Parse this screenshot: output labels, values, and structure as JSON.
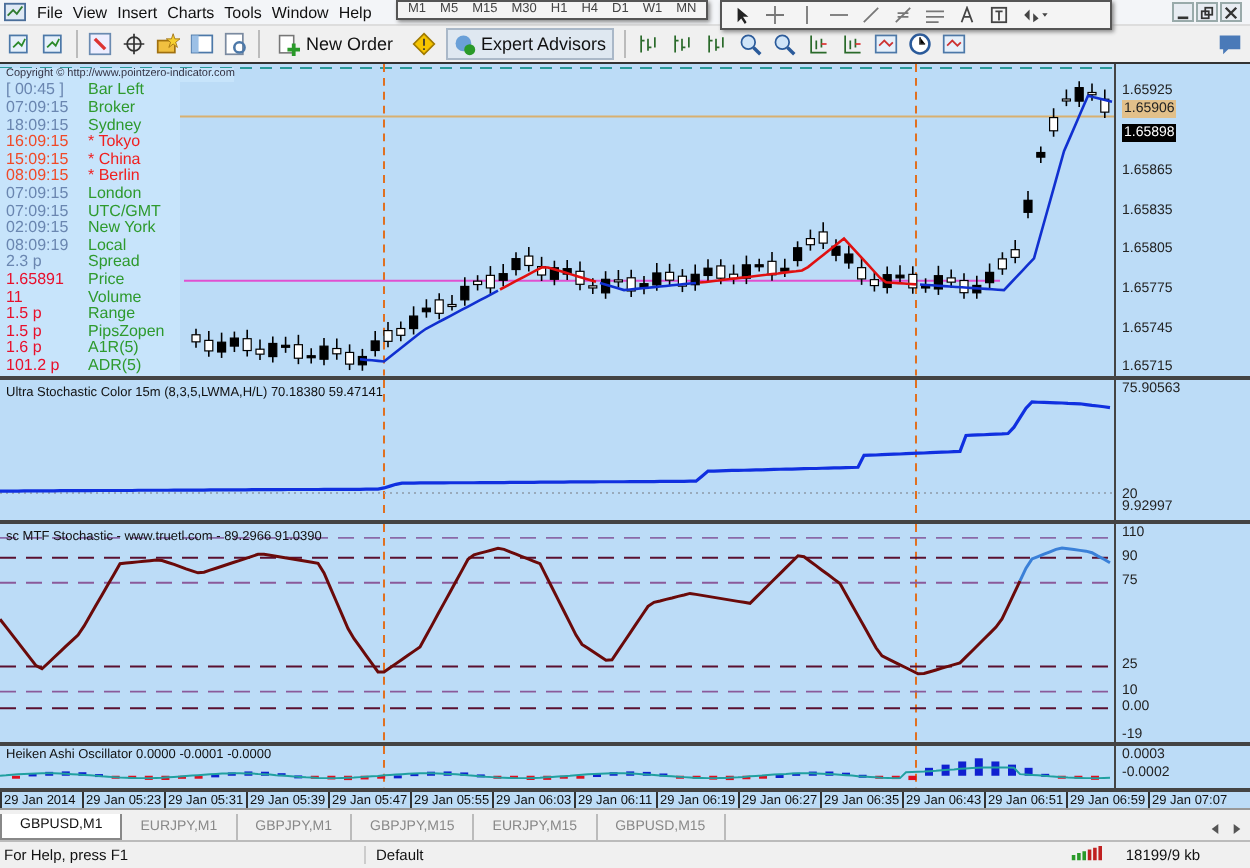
{
  "menu": [
    "File",
    "View",
    "Insert",
    "Charts",
    "Tools",
    "Window",
    "Help"
  ],
  "timeframes": [
    "M1",
    "M5",
    "M15",
    "M30",
    "H1",
    "H4",
    "D1",
    "W1",
    "MN"
  ],
  "toolbar": {
    "new_order": "New Order",
    "expert_advisors": "Expert Advisors"
  },
  "main_chart": {
    "copyright": "Copyright © http://www.pointzero-indicator.com",
    "info_rows": [
      {
        "value": {
          "text": "[ 00:45 ]",
          "color": "#6a86b0"
        },
        "label": {
          "text": "Bar Left",
          "color": "#2e9a2e"
        }
      },
      {
        "value": {
          "text": "07:09:15",
          "color": "#6a86b0"
        },
        "label": {
          "text": "Broker",
          "color": "#2e9a2e"
        }
      },
      {
        "value": {
          "text": "18:09:15",
          "color": "#6a86b0"
        },
        "label": {
          "text": "Sydney",
          "color": "#2e9a2e"
        }
      },
      {
        "value": {
          "text": "16:09:15",
          "color": "#f04a28"
        },
        "label": {
          "text": "* Tokyo",
          "color": "#f02020"
        }
      },
      {
        "value": {
          "text": "15:09:15",
          "color": "#f04a28"
        },
        "label": {
          "text": "* China",
          "color": "#f02020"
        }
      },
      {
        "value": {
          "text": "08:09:15",
          "color": "#f04a28"
        },
        "label": {
          "text": "* Berlin",
          "color": "#f02020"
        }
      },
      {
        "value": {
          "text": "07:09:15",
          "color": "#6a86b0"
        },
        "label": {
          "text": "London",
          "color": "#2e9a2e"
        }
      },
      {
        "value": {
          "text": "07:09:15",
          "color": "#6a86b0"
        },
        "label": {
          "text": "UTC/GMT",
          "color": "#2e9a2e"
        }
      },
      {
        "value": {
          "text": "02:09:15",
          "color": "#6a86b0"
        },
        "label": {
          "text": "New York",
          "color": "#2e9a2e"
        }
      },
      {
        "value": {
          "text": "08:09:19",
          "color": "#6a86b0"
        },
        "label": {
          "text": "Local",
          "color": "#2e9a2e"
        }
      },
      {
        "value": {
          "text": "2.3 p",
          "color": "#6a86b0"
        },
        "label": {
          "text": "Spread",
          "color": "#2e9a2e"
        }
      },
      {
        "value": {
          "text": "1.65891",
          "color": "#e8102c"
        },
        "label": {
          "text": "Price",
          "color": "#2e9a2e"
        }
      },
      {
        "value": {
          "text": "11",
          "color": "#e8102c"
        },
        "label": {
          "text": "Volume",
          "color": "#2e9a2e"
        }
      },
      {
        "value": {
          "text": "1.5 p",
          "color": "#e8102c"
        },
        "label": {
          "text": "Range",
          "color": "#2e9a2e"
        }
      },
      {
        "value": {
          "text": "1.5 p",
          "color": "#e8102c"
        },
        "label": {
          "text": "PipsZopen",
          "color": "#2e9a2e"
        }
      },
      {
        "value": {
          "text": "1.6 p",
          "color": "#e8102c"
        },
        "label": {
          "text": "A1R(5)",
          "color": "#2e9a2e"
        }
      },
      {
        "value": {
          "text": "101.2 p",
          "color": "#e8102c"
        },
        "label": {
          "text": "ADR(5)",
          "color": "#2e9a2e"
        }
      }
    ],
    "price_axis": [
      {
        "text": "1.65925",
        "kind": "tick"
      },
      {
        "text": "1.65906",
        "kind": "ask"
      },
      {
        "text": "1.65898",
        "kind": "bid"
      },
      {
        "text": "1.65865",
        "kind": "tick"
      },
      {
        "text": "1.65835",
        "kind": "tick"
      },
      {
        "text": "1.65805",
        "kind": "tick"
      },
      {
        "text": "1.65775",
        "kind": "tick"
      },
      {
        "text": "1.65745",
        "kind": "tick"
      },
      {
        "text": "1.65715",
        "kind": "tick"
      }
    ]
  },
  "indicators": [
    {
      "kind": "ultra",
      "title": "Ultra Stochastic Color 15m (8,3,5,LWMA,H/L) 70.18380 59.47141",
      "axis": [
        "75.90563",
        "20",
        "9.92997"
      ]
    },
    {
      "kind": "mtf",
      "title": "sc MTF Stochastic - www.truetl.com - 89.2966 91.0390",
      "axis": [
        "110",
        "90",
        "75",
        "25",
        "10",
        "0.00",
        "-19"
      ]
    },
    {
      "kind": "heiken",
      "title": "Heiken Ashi Oscillator 0.0000 -0.0001 -0.0000",
      "axis": [
        "0.0003",
        "-0.0002"
      ]
    }
  ],
  "time_axis": [
    "29 Jan 2014",
    "29 Jan 05:23",
    "29 Jan 05:31",
    "29 Jan 05:39",
    "29 Jan 05:47",
    "29 Jan 05:55",
    "29 Jan 06:03",
    "29 Jan 06:11",
    "29 Jan 06:19",
    "29 Jan 06:27",
    "29 Jan 06:35",
    "29 Jan 06:43",
    "29 Jan 06:51",
    "29 Jan 06:59",
    "29 Jan 07:07"
  ],
  "tabs": [
    {
      "label": "GBPUSD,M1",
      "selected": true
    },
    {
      "label": "EURJPY,M1",
      "selected": false
    },
    {
      "label": "GBPJPY,M1",
      "selected": false
    },
    {
      "label": "GBPJPY,M15",
      "selected": false
    },
    {
      "label": "EURJPY,M15",
      "selected": false
    },
    {
      "label": "GBPUSD,M15",
      "selected": false
    }
  ],
  "status_bar": {
    "help": "For Help, press F1",
    "profile": "Default",
    "traffic": "18199/9 kb"
  }
}
